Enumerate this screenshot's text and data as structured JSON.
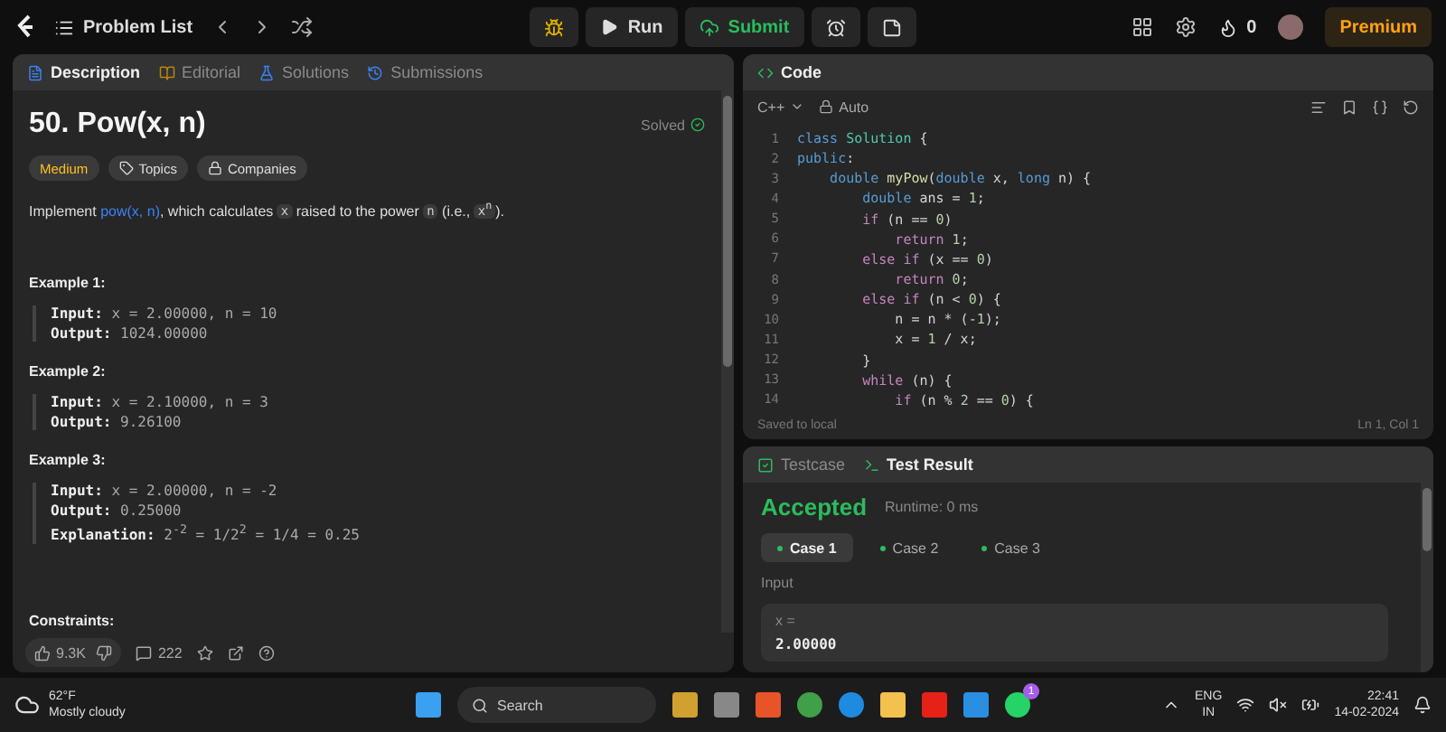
{
  "topbar": {
    "problem_list": "Problem List",
    "run": "Run",
    "submit": "Submit",
    "streak": "0",
    "premium": "Premium"
  },
  "description": {
    "tabs": [
      {
        "label": "Description",
        "selected": true
      },
      {
        "label": "Editorial",
        "selected": false
      },
      {
        "label": "Solutions",
        "selected": false
      },
      {
        "label": "Submissions",
        "selected": false
      }
    ],
    "title": "50. Pow(x, n)",
    "status": "Solved",
    "tags": [
      {
        "kind": "difficulty",
        "label": "Medium"
      },
      {
        "kind": "topics",
        "label": "Topics"
      },
      {
        "kind": "companies",
        "label": "Companies"
      }
    ],
    "statement": [
      {
        "kind": "text",
        "text": "Implement "
      },
      {
        "kind": "link",
        "text": "pow(x, n)"
      },
      {
        "kind": "text",
        "text": ", which calculates "
      },
      {
        "kind": "code",
        "text": "x"
      },
      {
        "kind": "text",
        "text": " raised to the power "
      },
      {
        "kind": "code",
        "text": "n"
      },
      {
        "kind": "text",
        "text": " (i.e., "
      },
      {
        "kind": "code",
        "text": "x$^{n}$"
      },
      {
        "kind": "text",
        "text": ")."
      }
    ],
    "examples": [
      {
        "title": "Example 1:",
        "lines": [
          "**Input:** x = 2.00000, n = 10",
          "**Output:** 1024.00000"
        ]
      },
      {
        "title": "Example 2:",
        "lines": [
          "**Input:** x = 2.10000, n = 3",
          "**Output:** 9.26100"
        ]
      },
      {
        "title": "Example 3:",
        "lines": [
          "**Input:** x = 2.00000, n = -2",
          "**Output:** 0.25000",
          "**Explanation:** 2$^{-2}$ = 1/2$^{2}$ = 1/4 = 0.25"
        ]
      }
    ],
    "constraints_title": "Constraints:",
    "footer": {
      "likes": "9.3K",
      "comments": "222"
    }
  },
  "code": {
    "title": "Code",
    "language": "C++",
    "mode": "Auto",
    "lines": [
      {
        "number": "1",
        "tokens": [
          {
            "kind": "keyword",
            "text": "class "
          },
          {
            "kind": "class",
            "text": "Solution"
          },
          {
            "kind": "plain",
            "text": " {"
          }
        ]
      },
      {
        "number": "2",
        "tokens": [
          {
            "kind": "keyword",
            "text": "public"
          },
          {
            "kind": "plain",
            "text": ":"
          }
        ]
      },
      {
        "number": "3",
        "tokens": [
          {
            "kind": "keyword",
            "text": "    double "
          },
          {
            "kind": "function",
            "text": "myPow"
          },
          {
            "kind": "plain",
            "text": "("
          },
          {
            "kind": "keyword",
            "text": "double "
          },
          {
            "kind": "plain",
            "text": "x, "
          },
          {
            "kind": "keyword",
            "text": "long "
          },
          {
            "kind": "plain",
            "text": "n) {"
          }
        ]
      },
      {
        "number": "4",
        "tokens": [
          {
            "kind": "keyword",
            "text": "        double "
          },
          {
            "kind": "plain",
            "text": "ans = "
          },
          {
            "kind": "number",
            "text": "1"
          },
          {
            "kind": "plain",
            "text": ";"
          }
        ]
      },
      {
        "number": "5",
        "tokens": [
          {
            "kind": "control",
            "text": "        if "
          },
          {
            "kind": "plain",
            "text": "(n == "
          },
          {
            "kind": "number",
            "text": "0"
          },
          {
            "kind": "plain",
            "text": ")"
          }
        ]
      },
      {
        "number": "6",
        "tokens": [
          {
            "kind": "control",
            "text": "            return "
          },
          {
            "kind": "number",
            "text": "1"
          },
          {
            "kind": "plain",
            "text": ";"
          }
        ]
      },
      {
        "number": "7",
        "tokens": [
          {
            "kind": "control",
            "text": "        else if "
          },
          {
            "kind": "plain",
            "text": "(x == "
          },
          {
            "kind": "number",
            "text": "0"
          },
          {
            "kind": "plain",
            "text": ")"
          }
        ]
      },
      {
        "number": "8",
        "tokens": [
          {
            "kind": "control",
            "text": "            return "
          },
          {
            "kind": "number",
            "text": "0"
          },
          {
            "kind": "plain",
            "text": ";"
          }
        ]
      },
      {
        "number": "9",
        "tokens": [
          {
            "kind": "control",
            "text": "        else if "
          },
          {
            "kind": "plain",
            "text": "(n < "
          },
          {
            "kind": "number",
            "text": "0"
          },
          {
            "kind": "plain",
            "text": ") {"
          }
        ]
      },
      {
        "number": "10",
        "tokens": [
          {
            "kind": "plain",
            "text": "            n = n * (-"
          },
          {
            "kind": "number",
            "text": "1"
          },
          {
            "kind": "plain",
            "text": ");"
          }
        ]
      },
      {
        "number": "11",
        "tokens": [
          {
            "kind": "plain",
            "text": "            x = "
          },
          {
            "kind": "number",
            "text": "1"
          },
          {
            "kind": "plain",
            "text": " / x;"
          }
        ]
      },
      {
        "number": "12",
        "tokens": [
          {
            "kind": "plain",
            "text": "        }"
          }
        ]
      },
      {
        "number": "13",
        "tokens": [
          {
            "kind": "control",
            "text": "        while "
          },
          {
            "kind": "plain",
            "text": "(n) {"
          }
        ]
      },
      {
        "number": "14",
        "tokens": [
          {
            "kind": "control",
            "text": "            if "
          },
          {
            "kind": "plain",
            "text": "(n % "
          },
          {
            "kind": "number",
            "text": "2"
          },
          {
            "kind": "plain",
            "text": " == "
          },
          {
            "kind": "number",
            "text": "0"
          },
          {
            "kind": "plain",
            "text": ") {"
          }
        ]
      }
    ],
    "saved": "Saved to local",
    "cursor": "Ln 1, Col 1"
  },
  "results": {
    "tabs": [
      {
        "label": "Testcase",
        "selected": false
      },
      {
        "label": "Test Result",
        "selected": true
      }
    ],
    "verdict": "Accepted",
    "runtime": "Runtime: 0 ms",
    "cases": [
      {
        "label": "Case 1",
        "selected": true
      },
      {
        "label": "Case 2",
        "selected": false
      },
      {
        "label": "Case 3",
        "selected": false
      }
    ],
    "input_label": "Input",
    "param": "x =",
    "value": "2.00000"
  },
  "taskbar": {
    "temperature": "62°F",
    "weather": "Mostly cloudy",
    "search": "Search",
    "chat_badge": "1",
    "language": "ENG",
    "region": "IN",
    "time": "22:41",
    "date": "14-02-2024"
  }
}
